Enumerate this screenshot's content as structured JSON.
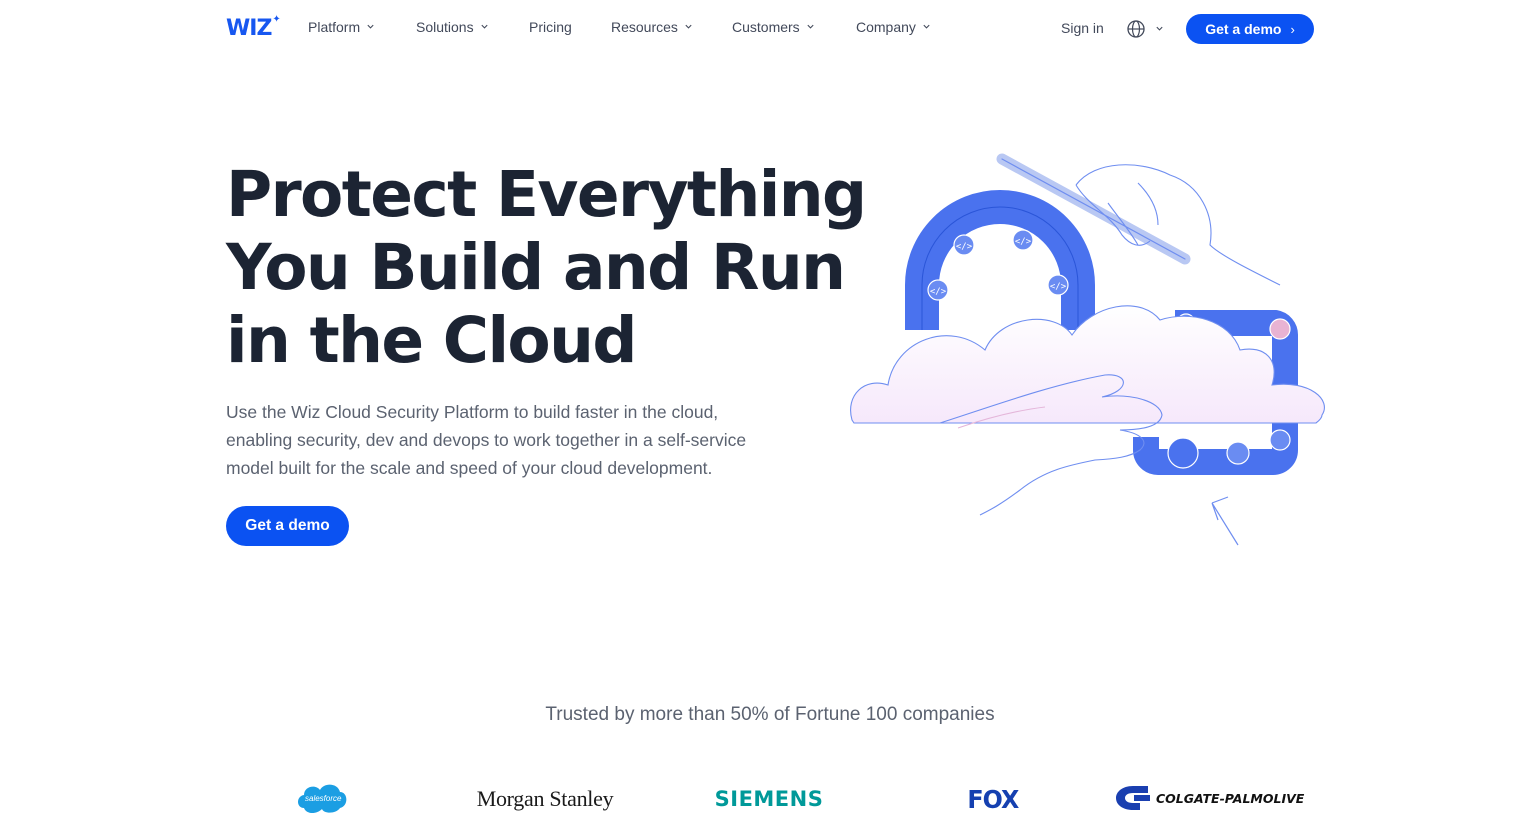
{
  "nav": {
    "logo": "WIZ",
    "items": [
      {
        "label": "Platform",
        "has_dropdown": true
      },
      {
        "label": "Solutions",
        "has_dropdown": true
      },
      {
        "label": "Pricing",
        "has_dropdown": false
      },
      {
        "label": "Resources",
        "has_dropdown": true
      },
      {
        "label": "Customers",
        "has_dropdown": true
      },
      {
        "label": "Company",
        "has_dropdown": true
      }
    ],
    "sign_in": "Sign in",
    "language_icon": "globe-icon",
    "cta": "Get a demo"
  },
  "hero": {
    "title_lines": [
      "Protect Everything",
      "You Build and Run",
      "in the Cloud"
    ],
    "subtitle_lines": [
      "Use the Wiz Cloud Security Platform to build faster in the cloud,",
      "enabling security, dev and devops to work together in a self-service",
      "model built for the scale and speed of your cloud development."
    ],
    "cta": "Get a demo"
  },
  "trusted": {
    "text": "Trusted by more than 50% of Fortune 100 companies",
    "logos": [
      "salesforce",
      "Morgan Stanley",
      "SIEMENS",
      "FOX",
      "COLGATE-PALMOLIVE"
    ]
  },
  "colors": {
    "brand_blue": "#0b52f2",
    "heading": "#1c2433",
    "body_text": "#5b6270",
    "illustration_blue": "#3d6ef0"
  }
}
